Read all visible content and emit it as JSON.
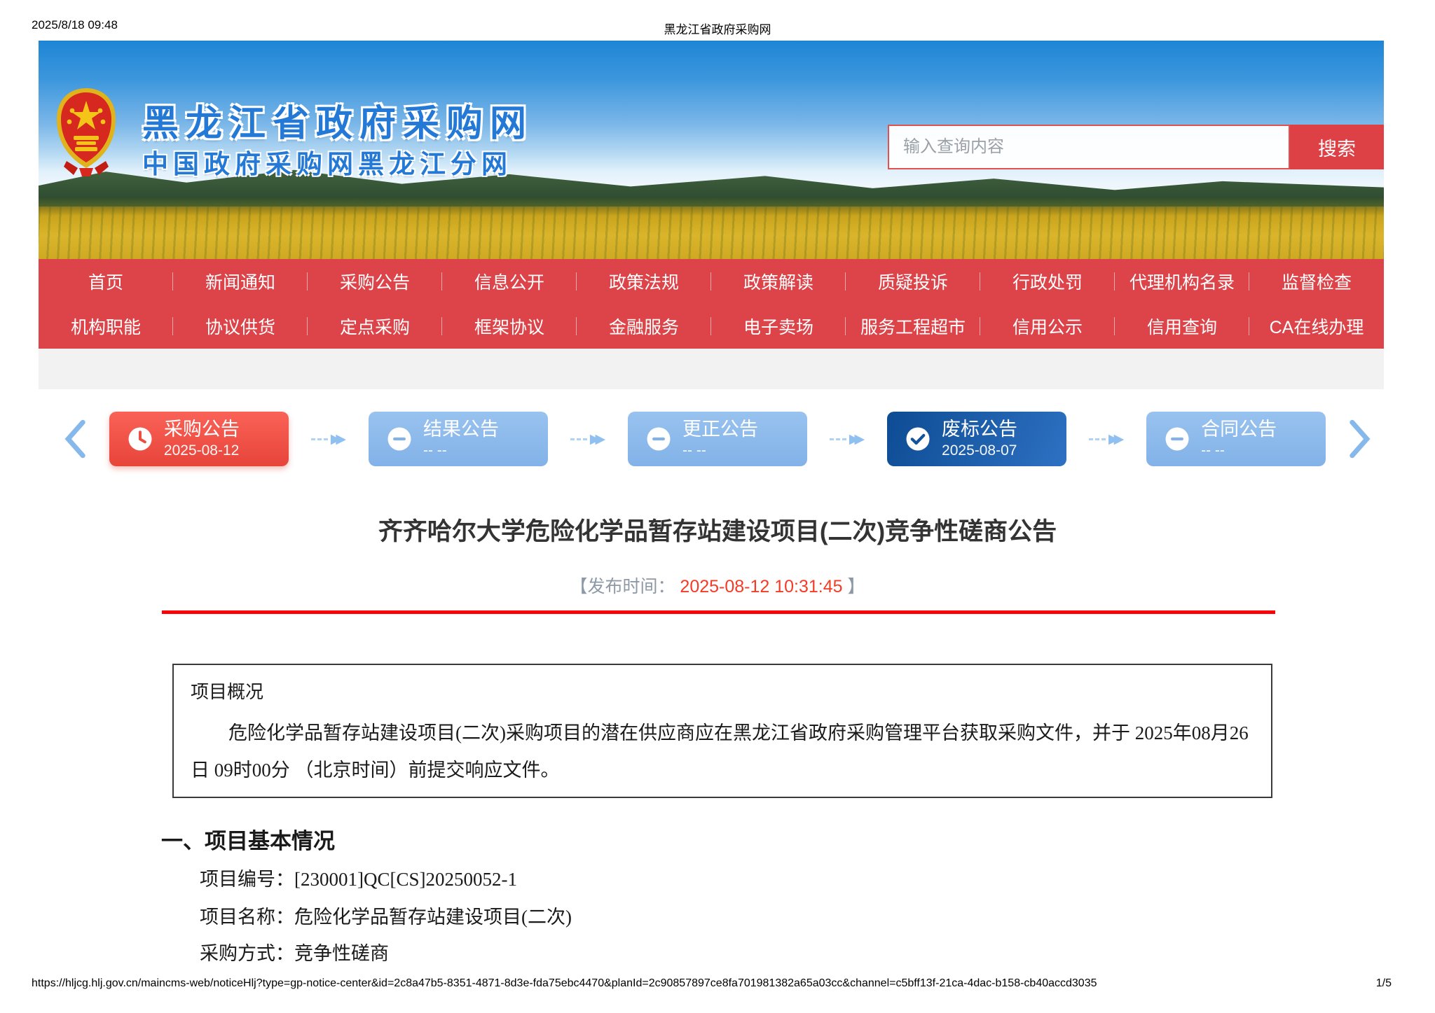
{
  "print_header": {
    "datetime": "2025/8/18 09:48",
    "title": "黑龙江省政府采购网"
  },
  "banner": {
    "site_title": "黑龙江省政府采购网",
    "site_subtitle": "中国政府采购网黑龙江分网",
    "emblem_icon": "china-national-emblem",
    "search": {
      "placeholder": "输入查询内容",
      "button_label": "搜索"
    },
    "colors": {
      "nav_red": "#dc4449",
      "search_button_red": "#dd4146",
      "title_blue": "#2479d6"
    }
  },
  "nav": {
    "row1": [
      "首页",
      "新闻通知",
      "采购公告",
      "信息公开",
      "政策法规",
      "政策解读",
      "质疑投诉",
      "行政处罚",
      "代理机构名录",
      "监督检查"
    ],
    "row2": [
      "机构职能",
      "协议供货",
      "定点采购",
      "框架协议",
      "金融服务",
      "电子卖场",
      "服务工程超市",
      "信用公示",
      "信用查询",
      "CA在线办理"
    ]
  },
  "stepper": {
    "steps": [
      {
        "label": "采购公告",
        "date": "2025-08-12",
        "state": "active-red",
        "icon": "clock-icon"
      },
      {
        "label": "结果公告",
        "date": "-- --",
        "state": "inactive",
        "icon": "minus-icon"
      },
      {
        "label": "更正公告",
        "date": "-- --",
        "state": "inactive",
        "icon": "minus-icon"
      },
      {
        "label": "废标公告",
        "date": "2025-08-07",
        "state": "active-blue",
        "icon": "check-icon"
      },
      {
        "label": "合同公告",
        "date": "-- --",
        "state": "inactive",
        "icon": "minus-icon"
      }
    ],
    "colors": {
      "active_red": "#e7443a",
      "inactive_blue": "#82b2e8",
      "active_dark_blue": "#0d4c93"
    }
  },
  "article": {
    "title": "齐齐哈尔大学危险化学品暂存站建设项目(二次)竞争性磋商公告",
    "publish_label_open": "【发布时间：",
    "publish_time": "2025-08-12 10:31:45",
    "publish_label_close": "】",
    "publish_time_color": "#f43b26",
    "overview_heading": "项目概况",
    "overview_text": "危险化学品暂存站建设项目(二次)采购项目的潜在供应商应在黑龙江省政府采购管理平台获取采购文件，并于  2025年08月26日  09时00分 （北京时间）前提交响应文件。",
    "section1_heading": "一、项目基本情况",
    "fields": [
      {
        "label": "项目编号：",
        "value": "[230001]QC[CS]20250052-1"
      },
      {
        "label": "项目名称：",
        "value": "危险化学品暂存站建设项目(二次)"
      },
      {
        "label": "采购方式：",
        "value": "竞争性磋商"
      }
    ]
  },
  "print_footer": {
    "url": "https://hljcg.hlj.gov.cn/maincms-web/noticeHlj?type=gp-notice-center&id=2c8a47b5-8351-4871-8d3e-fda75ebc4470&planId=2c90857897ce8fa701981382a65a03cc&channel=c5bff13f-21ca-4dac-b158-cb40accd3035",
    "page": "1/5"
  }
}
